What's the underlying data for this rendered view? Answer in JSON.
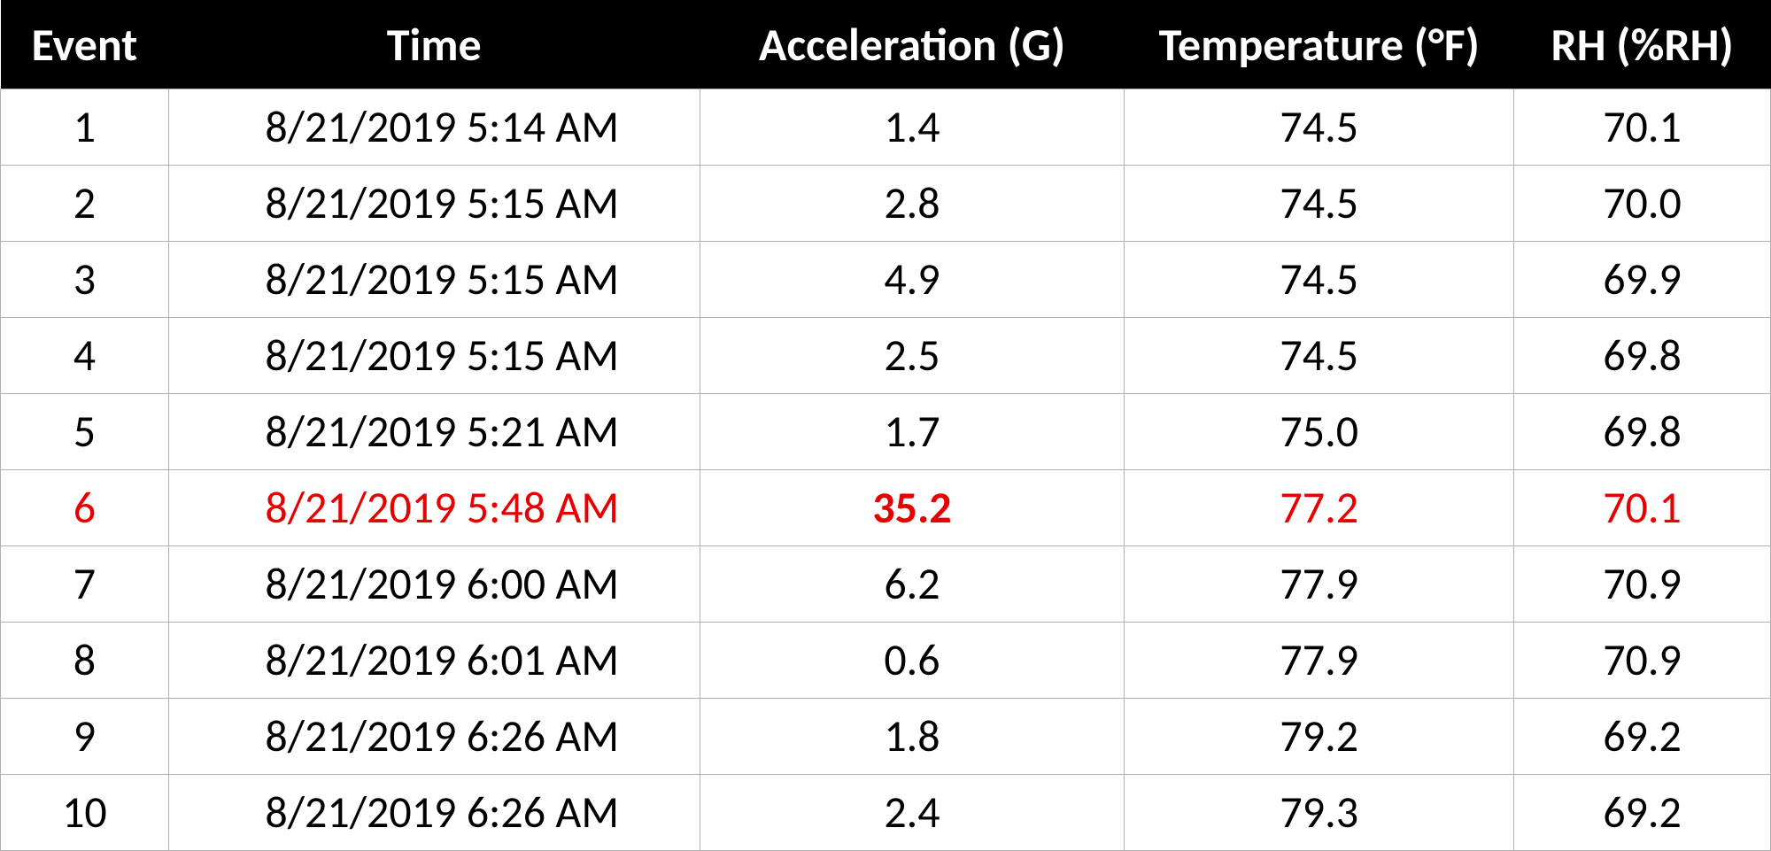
{
  "chart_data": {
    "type": "table",
    "title": "",
    "columns": [
      "Event",
      "Time",
      "Acceleration (G)",
      "Temperature (°F)",
      "RH (%RH)"
    ],
    "rows": [
      {
        "event": "1",
        "time": "8/21/2019 5:14 AM",
        "accel": "1.4",
        "temp": "74.5",
        "rh": "70.1",
        "highlight": false
      },
      {
        "event": "2",
        "time": "8/21/2019 5:15 AM",
        "accel": "2.8",
        "temp": "74.5",
        "rh": "70.0",
        "highlight": false
      },
      {
        "event": "3",
        "time": "8/21/2019 5:15 AM",
        "accel": "4.9",
        "temp": "74.5",
        "rh": "69.9",
        "highlight": false
      },
      {
        "event": "4",
        "time": "8/21/2019 5:15 AM",
        "accel": "2.5",
        "temp": "74.5",
        "rh": "69.8",
        "highlight": false
      },
      {
        "event": "5",
        "time": "8/21/2019 5:21 AM",
        "accel": "1.7",
        "temp": "75.0",
        "rh": "69.8",
        "highlight": false
      },
      {
        "event": "6",
        "time": "8/21/2019 5:48 AM",
        "accel": "35.2",
        "temp": "77.2",
        "rh": "70.1",
        "highlight": true
      },
      {
        "event": "7",
        "time": "8/21/2019 6:00 AM",
        "accel": "6.2",
        "temp": "77.9",
        "rh": "70.9",
        "highlight": false
      },
      {
        "event": "8",
        "time": "8/21/2019 6:01 AM",
        "accel": "0.6",
        "temp": "77.9",
        "rh": "70.9",
        "highlight": false
      },
      {
        "event": "9",
        "time": "8/21/2019 6:26 AM",
        "accel": "1.8",
        "temp": "79.2",
        "rh": "69.2",
        "highlight": false
      },
      {
        "event": "10",
        "time": "8/21/2019 6:26 AM",
        "accel": "2.4",
        "temp": "79.3",
        "rh": "69.2",
        "highlight": false
      }
    ],
    "highlight_color": "#e60000"
  }
}
